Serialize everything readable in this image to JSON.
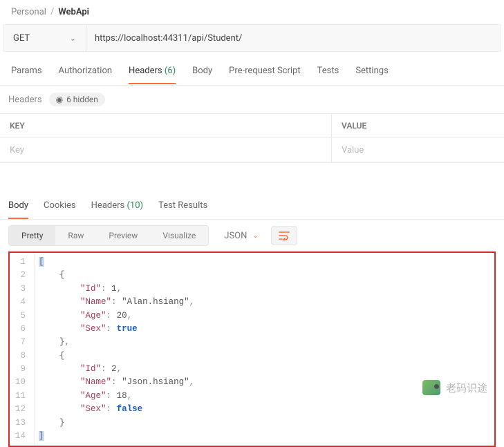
{
  "breadcrumb": {
    "root": "Personal",
    "sep": "/",
    "current": "WebApi"
  },
  "request": {
    "method": "GET",
    "url": "https://localhost:44311/api/Student/"
  },
  "reqTabs": {
    "params": "Params",
    "auth": "Authorization",
    "headers": "Headers",
    "headersCount": "(6)",
    "body": "Body",
    "pre": "Pre-request Script",
    "tests": "Tests",
    "settings": "Settings"
  },
  "headersSub": {
    "label": "Headers",
    "hidden": "6 hidden"
  },
  "kv": {
    "keyHeader": "KEY",
    "valueHeader": "VALUE",
    "keyPlaceholder": "Key",
    "valuePlaceholder": "Value"
  },
  "respTabs": {
    "body": "Body",
    "cookies": "Cookies",
    "headers": "Headers",
    "headersCount": "(10)",
    "testResults": "Test Results"
  },
  "viewTabs": {
    "pretty": "Pretty",
    "raw": "Raw",
    "preview": "Preview",
    "visualize": "Visualize"
  },
  "format": "JSON",
  "code": {
    "lines": [
      "[",
      "    {",
      "        \"Id\": 1,",
      "        \"Name\": \"Alan.hsiang\",",
      "        \"Age\": 20,",
      "        \"Sex\": true",
      "    },",
      "    {",
      "        \"Id\": 2,",
      "        \"Name\": \"Json.hsiang\",",
      "        \"Age\": 18,",
      "        \"Sex\": false",
      "    }",
      "]"
    ]
  },
  "watermark": "老码识途"
}
